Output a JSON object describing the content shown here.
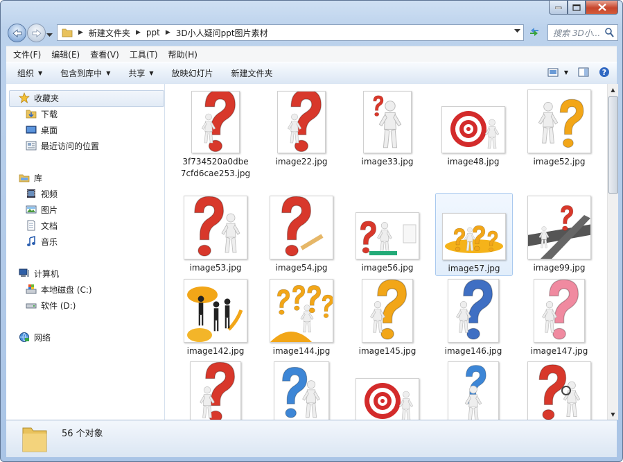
{
  "address": {
    "crumbs": [
      "新建文件夹",
      "ppt",
      "3D小人疑问ppt图片素材"
    ],
    "search_placeholder": "搜索 3D小..."
  },
  "menu": [
    "文件(F)",
    "编辑(E)",
    "查看(V)",
    "工具(T)",
    "帮助(H)"
  ],
  "commands": {
    "organize": "组织",
    "include_library": "包含到库中",
    "share": "共享",
    "slideshow": "放映幻灯片",
    "new_folder": "新建文件夹"
  },
  "nav": {
    "favorites": "收藏夹",
    "downloads": "下载",
    "desktop": "桌面",
    "recent": "最近访问的位置",
    "libraries": "库",
    "videos": "视频",
    "pictures": "图片",
    "documents": "文档",
    "music": "音乐",
    "computer": "计算机",
    "drive_c": "本地磁盘 (C:)",
    "drive_d": "软件 (D:)",
    "network": "网络"
  },
  "files": [
    {
      "name": "3f734520a0dbe7cfd6cae253.jpg",
      "kind": "red-q-sit"
    },
    {
      "name": "image22.jpg",
      "kind": "red-q-sit"
    },
    {
      "name": "image33.jpg",
      "kind": "man-small-q"
    },
    {
      "name": "image48.jpg",
      "kind": "target"
    },
    {
      "name": "image52.jpg",
      "kind": "yellow-q-think"
    },
    {
      "name": "image53.jpg",
      "kind": "red-q-push"
    },
    {
      "name": "image54.jpg",
      "kind": "red-q-lean"
    },
    {
      "name": "image56.jpg",
      "kind": "presenter"
    },
    {
      "name": "image57.jpg",
      "kind": "yellow-pile",
      "selected": true
    },
    {
      "name": "image99.jpg",
      "kind": "crossroad"
    },
    {
      "name": "image142.jpg",
      "kind": "black-figures"
    },
    {
      "name": "image144.jpg",
      "kind": "yellow-many"
    },
    {
      "name": "image145.jpg",
      "kind": "yellow-q-lean"
    },
    {
      "name": "image146.jpg",
      "kind": "blue-q-lean"
    },
    {
      "name": "image147.jpg",
      "kind": "pink-q-lean"
    },
    {
      "name": "",
      "kind": "red-q-hold"
    },
    {
      "name": "",
      "kind": "blue-q-man"
    },
    {
      "name": "",
      "kind": "target"
    },
    {
      "name": "",
      "kind": "blue-q-carry"
    },
    {
      "name": "",
      "kind": "red-q-magnify"
    }
  ],
  "status": {
    "count": "56 个对象"
  },
  "colors": {
    "red": "#d8382b",
    "yellow": "#f2a618",
    "blue": "#3f6fc3",
    "pink": "#f08aa0"
  }
}
